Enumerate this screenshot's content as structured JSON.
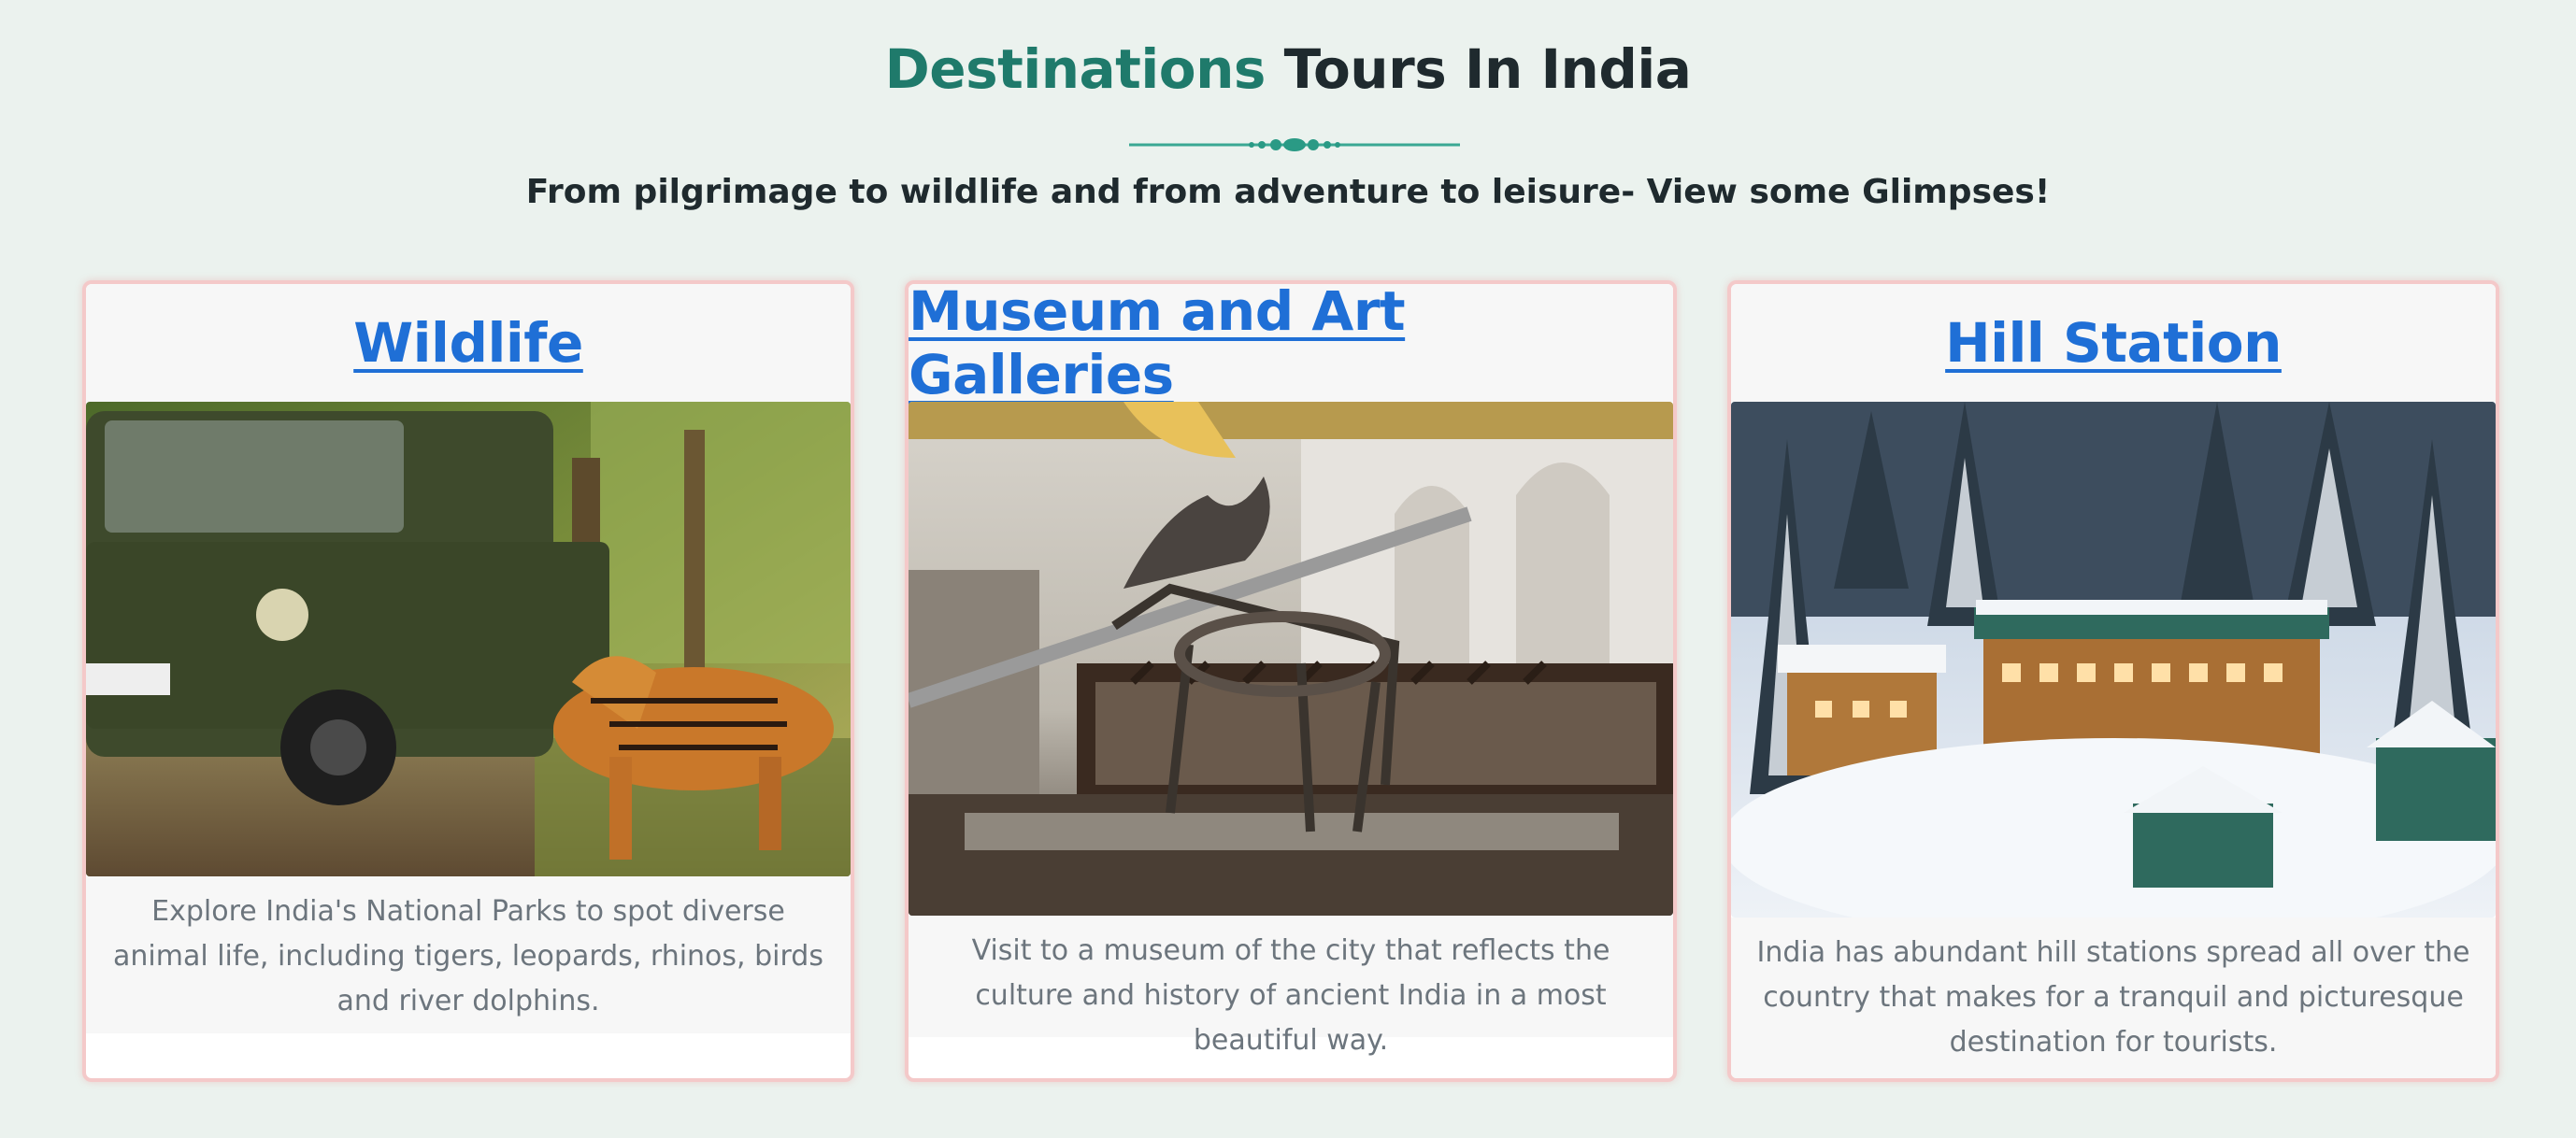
{
  "header": {
    "title_accent": "Destinations",
    "title_rest": " Tours In India",
    "subtitle": "From pilgrimage to wildlife and from adventure to leisure- View some Glimpses!"
  },
  "colors": {
    "background": "#ebf2ee",
    "accent": "#1f7a6b",
    "link": "#1f6fd6",
    "card_border": "#f4c9c9",
    "body_text": "#6c757d"
  },
  "cards": [
    {
      "title": "Wildlife",
      "image": "tiger-jeep-safari-image",
      "description": "Explore India's National Parks to spot diverse animal life, including tigers, leopards, rhinos, birds and river dolphins."
    },
    {
      "title": "Museum and Art Galleries",
      "image": "museum-skeleton-hall-image",
      "description": "Visit to a museum of the city that reflects the culture and history of ancient India in a most beautiful way."
    },
    {
      "title": "Hill Station",
      "image": "snowy-hill-hotel-image",
      "description": "India has abundant hill stations spread all over the country that makes for a tranquil and picturesque destination for tourists."
    }
  ]
}
